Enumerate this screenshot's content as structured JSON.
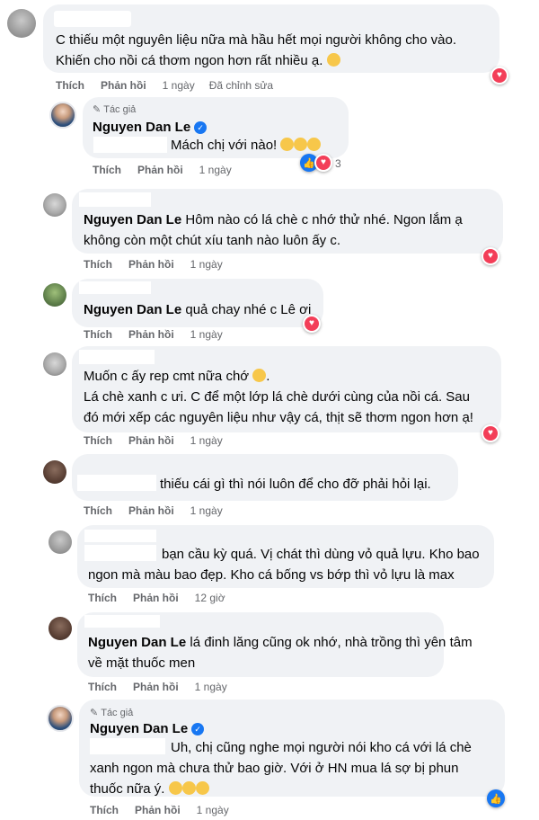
{
  "actions": {
    "like": "Thích",
    "reply": "Phản hồi"
  },
  "author_label": "Tác giả",
  "comments": [
    {
      "lines": [
        "C thiếu một nguyên liệu nữa mà hầu hết mọi người không cho vào.",
        "Khiến cho nồi cá thơm ngon hơn rất nhiều ạ."
      ],
      "time": "1 ngày",
      "edited": "Đã chỉnh sửa"
    },
    {
      "name": "Nguyen Dan Le",
      "lines": [
        "Mách chị với nào!"
      ],
      "time": "1 ngày",
      "reaction_count": "3"
    },
    {
      "name": "Nguyen Dan Le",
      "lines": [
        "Hôm nào có lá chè c nhớ thử nhé. Ngon lắm ạ",
        "không còn một chút xíu tanh nào luôn ấy c."
      ],
      "time": "1 ngày"
    },
    {
      "name": "Nguyen Dan Le",
      "lines": [
        "quả chay nhé c Lê ơi"
      ],
      "time": "1 ngày"
    },
    {
      "lines": [
        "Muốn c ấy rep cmt nữa chớ",
        "Lá chè xanh c ưi. C để một lớp lá chè dưới cùng của nồi cá. Sau",
        "đó mới xếp các nguyên liệu như vậy cá, thịt sẽ thơm ngon hơn ạ!"
      ],
      "time": "1 ngày"
    },
    {
      "lines": [
        "thiếu cái gì thì nói luôn để cho đỡ phải hỏi lại."
      ],
      "time": "1 ngày"
    },
    {
      "lines": [
        "bạn cầu kỳ quá. Vị chát thì dùng vỏ quả lựu. Kho bao",
        "ngon mà màu bao đẹp. Kho cá bống vs bớp thì vỏ lựu là max"
      ],
      "time": "12 giờ"
    },
    {
      "name": "Nguyen Dan Le",
      "lines": [
        "lá đinh lăng cũng ok nhớ, nhà trồng thì yên tâm",
        "về mặt thuốc men"
      ],
      "time": "1 ngày"
    },
    {
      "name": "Nguyen Dan Le",
      "lines": [
        "Uh, chị cũng nghe mọi người nói kho cá với lá chè",
        "xanh ngon mà chưa thử bao giờ. Với ở HN mua lá sợ bị phun",
        "thuốc nữa ý."
      ],
      "time": "1 ngày"
    }
  ],
  "colors": {
    "bubble": "#f0f2f5",
    "meta_text": "#65676b",
    "love": "#f33e58",
    "like": "#1877f2"
  },
  "icons": [
    "pencil-icon",
    "verified-badge-icon",
    "love-reaction-icon",
    "like-reaction-icon",
    "smile-emoji-icon",
    "heart-eyes-emoji-icon"
  ]
}
